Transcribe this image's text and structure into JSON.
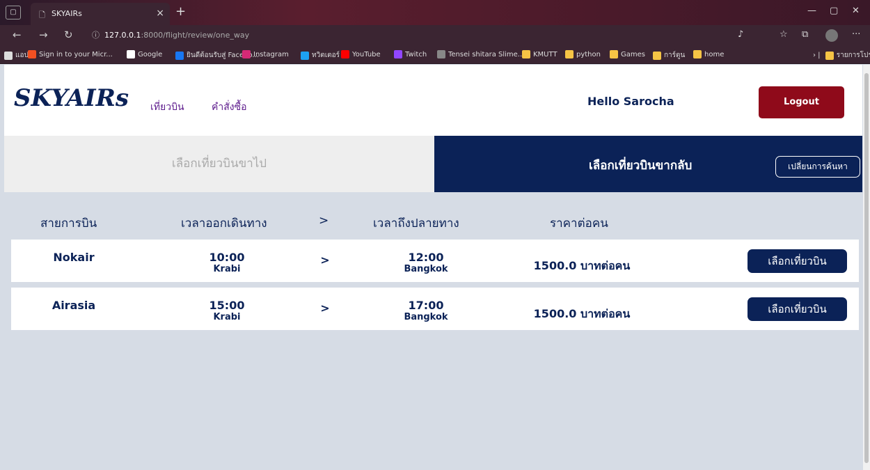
{
  "browser": {
    "tab_title": "SKYAIRs",
    "tab_close": "×",
    "new_tab": "+",
    "url_host": "127.0.0.1",
    "url_path": ":8000/flight/review/one_way",
    "bookmarks": [
      {
        "label": "แอป",
        "color": "#dddddd"
      },
      {
        "label": "Sign in to your Micr...",
        "color": "#f25022"
      },
      {
        "label": "Google",
        "color": "#ffffff"
      },
      {
        "label": "ยินดีต้อนรับสู่ Facebo...",
        "color": "#1877f2"
      },
      {
        "label": "Instagram",
        "color": "#d62976"
      },
      {
        "label": "ทวิตเตอร์",
        "color": "#1da1f2"
      },
      {
        "label": "YouTube",
        "color": "#ff0000"
      },
      {
        "label": "Twitch",
        "color": "#9146ff"
      },
      {
        "label": "Tensei shitara Slime...",
        "color": "#888888"
      },
      {
        "label": "KMUTT",
        "color": "#f6c445"
      },
      {
        "label": "python",
        "color": "#f6c445"
      },
      {
        "label": "Games",
        "color": "#f6c445"
      },
      {
        "label": "การ์ตูน",
        "color": "#f6c445"
      },
      {
        "label": "home",
        "color": "#f6c445"
      }
    ],
    "other_bookmarks": "รายการโปรดอื่นๆ"
  },
  "header": {
    "logo": "SKYAIRs",
    "nav": [
      "เที่ยวบิน",
      "คำสั่งซื้อ"
    ],
    "greeting": "Hello Sarocha",
    "logout_label": "Logout"
  },
  "steps": {
    "outbound": "เลือกเที่ยวบินขาไป",
    "return": "เลือกเที่ยวบินขากลับ",
    "change_search": "เปลี่ยนการค้นหา"
  },
  "columns": {
    "airline": "สายการบิน",
    "depart": "เวลาออกเดินทาง",
    "arrow": ">",
    "arrive": "เวลาถึงปลายทาง",
    "price": "ราคาต่อคน"
  },
  "flights": [
    {
      "airline": "Nokair",
      "dep_time": "10:00",
      "dep_city": "Krabi",
      "arrow": ">",
      "arr_time": "12:00",
      "arr_city": "Bangkok",
      "price": "1500.0 บาทต่อคน",
      "select": "เลือกเที่ยวบิน"
    },
    {
      "airline": "Airasia",
      "dep_time": "15:00",
      "dep_city": "Krabi",
      "arrow": ">",
      "arr_time": "17:00",
      "arr_city": "Bangkok",
      "price": "1500.0 บาทต่อคน",
      "select": "เลือกเที่ยวบิน"
    }
  ],
  "colors": {
    "brand_navy": "#0b2257",
    "logout_red": "#8f0a1a",
    "nav_purple": "#5c1a8c",
    "page_bg": "#d6dce5"
  }
}
